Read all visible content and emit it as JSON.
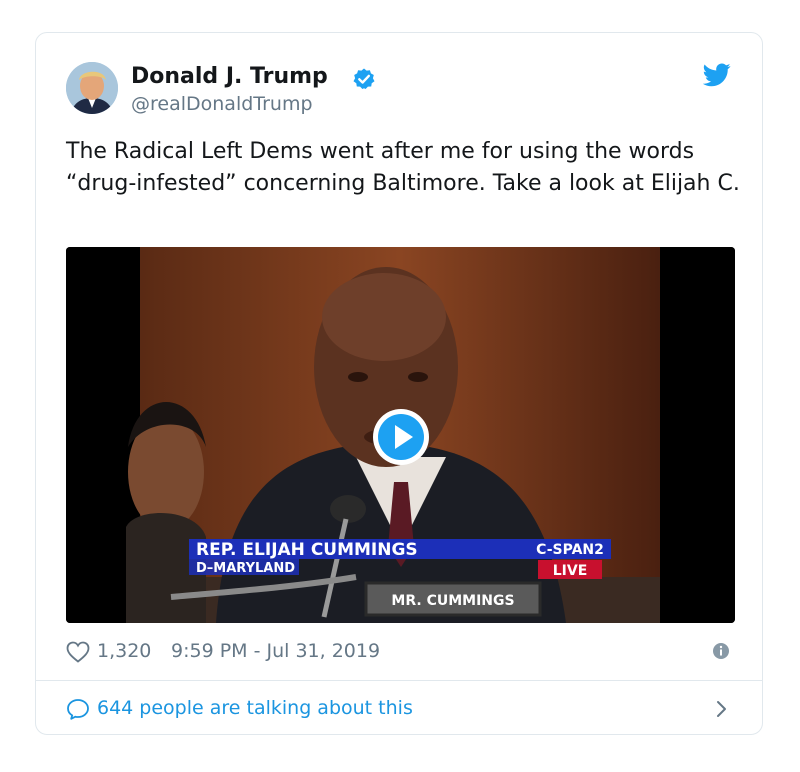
{
  "tweet": {
    "author": {
      "display_name": "Donald J. Trump",
      "handle": "@realDonaldTrump",
      "verified": true
    },
    "text": "The Radical Left Dems went after me for using the words “drug-infested” concerning Baltimore. Take a look at Elijah C.",
    "media": {
      "chyron_name": "REP. ELIJAH CUMMINGS",
      "chyron_sub": "D–MARYLAND",
      "network": "C-SPAN2",
      "live_label": "LIVE",
      "nameplate": "MR. CUMMINGS"
    },
    "likes": "1,320",
    "timestamp": "9:59 PM - Jul 31, 2019",
    "talking": "644 people are talking about this"
  },
  "icons": {
    "verified": "verified-badge-icon",
    "bird": "twitter-bird-icon",
    "heart": "heart-outline-icon",
    "info": "info-icon",
    "bubble": "speech-bubble-icon",
    "chevron": "chevron-right-icon",
    "play": "play-icon"
  },
  "colors": {
    "brand_blue": "#1da1f2",
    "link_blue": "#1b95e0",
    "text": "#14171a",
    "secondary": "#657786",
    "border": "#e1e8ed",
    "chyron_blue": "#1c2fb8",
    "live_red": "#c8102e"
  }
}
